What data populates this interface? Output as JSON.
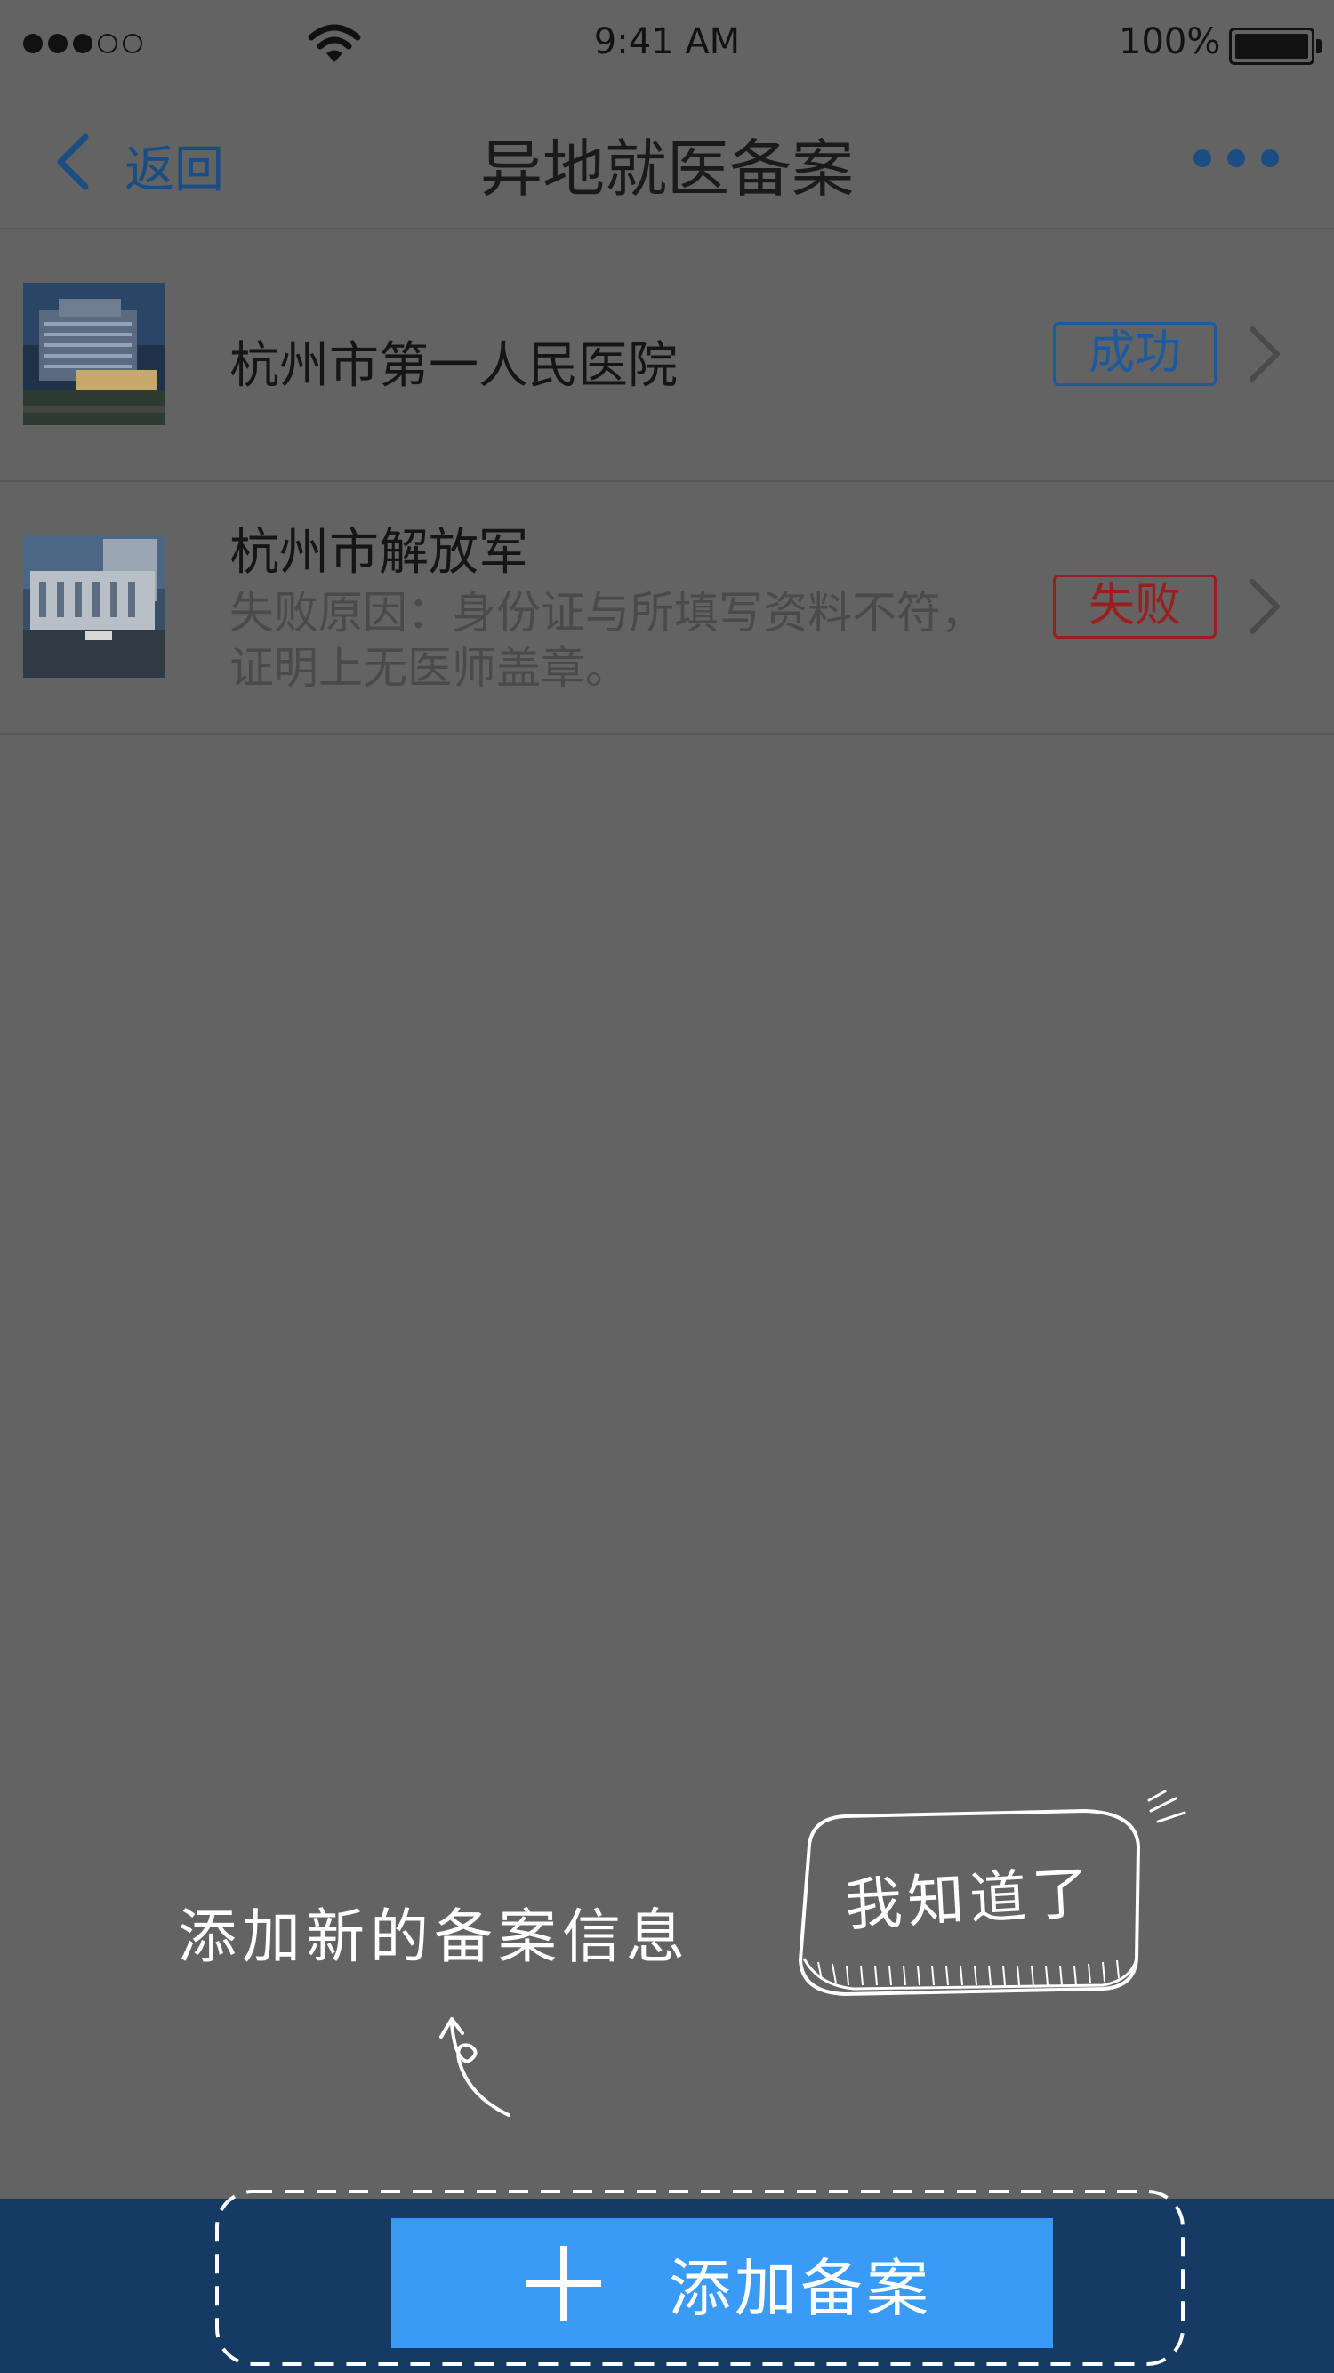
{
  "status_bar": {
    "time": "9:41 AM",
    "battery": "100%"
  },
  "nav": {
    "back_label": "返回",
    "title": "异地就医备案"
  },
  "records": [
    {
      "name": "杭州市第一人民医院",
      "status": "成功",
      "detail": ""
    },
    {
      "name": "杭州市解放军",
      "status": "失败",
      "detail_line1": "失败原因：身份证与所填写资料不符，",
      "detail_line2": "证明上无医师盖章。"
    }
  ],
  "guide": {
    "hint": "添加新的备案信息",
    "dismiss": "我知道了"
  },
  "bottom": {
    "add_label": "添加备案"
  },
  "colors": {
    "accent": "#3a9bf7",
    "bottom_bar": "#153a64",
    "success": "#1c5aa0",
    "fail": "#9b1e1e",
    "overlay": "#636363"
  }
}
